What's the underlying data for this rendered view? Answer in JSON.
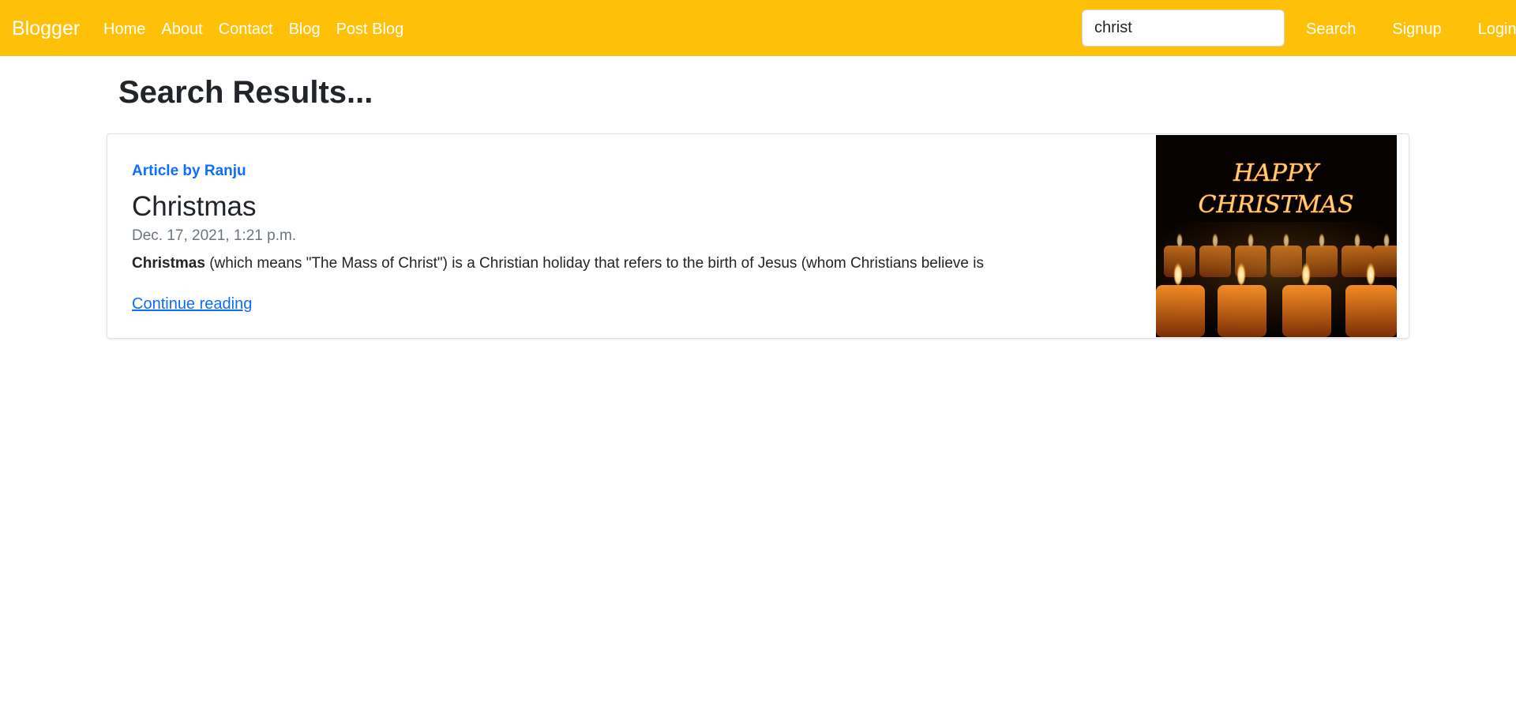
{
  "navbar": {
    "brand": "Blogger",
    "links": [
      "Home",
      "About",
      "Contact",
      "Blog",
      "Post Blog"
    ],
    "search_value": "christ",
    "search_button": "Search",
    "signup": "Signup",
    "login": "Login",
    "color": "#ffc107"
  },
  "page": {
    "title": "Search Results..."
  },
  "results": [
    {
      "author": "Article by Ranju",
      "title": "Christmas",
      "date": "Dec. 17, 2021, 1:21 p.m.",
      "excerpt_bold": "Christmas",
      "excerpt_rest": " (which means \"The Mass of Christ\") is a Christian holiday that refers to the birth of Jesus (whom Christians believe is",
      "continue_label": "Continue reading",
      "image_text": "HAPPY CHRISTMAS"
    }
  ]
}
